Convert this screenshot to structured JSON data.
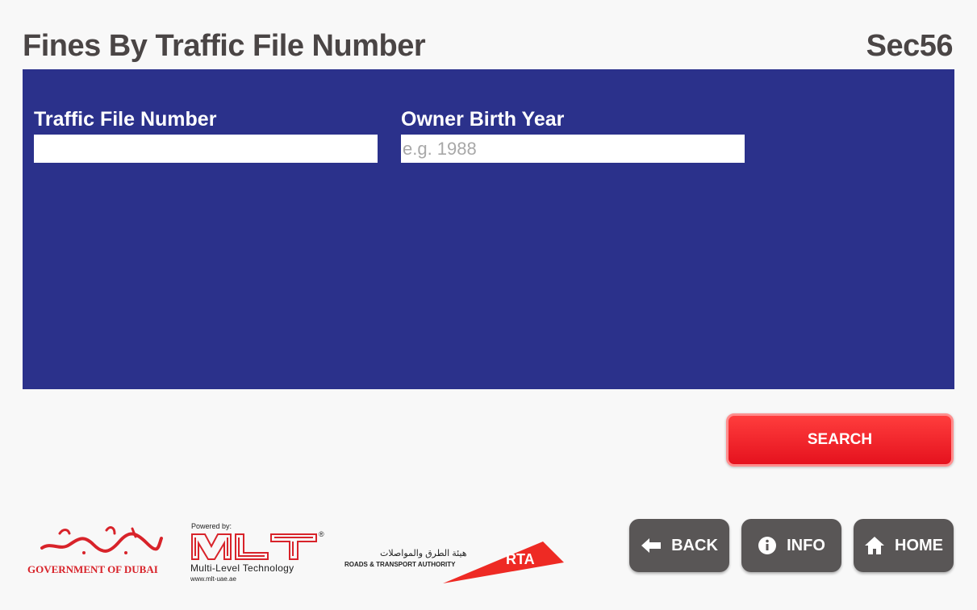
{
  "header": {
    "title": "Fines By Traffic File Number",
    "section_code": "Sec56"
  },
  "form": {
    "traffic_file_number": {
      "label": "Traffic File Number",
      "value": "",
      "placeholder": ""
    },
    "owner_birth_year": {
      "label": "Owner Birth Year",
      "value": "",
      "placeholder": "e.g. 1988"
    }
  },
  "actions": {
    "search_label": "SEARCH"
  },
  "nav": {
    "back": {
      "label": "BACK",
      "icon": "arrow-left-icon"
    },
    "info": {
      "label": "INFO",
      "icon": "info-icon"
    },
    "home": {
      "label": "HOME",
      "icon": "home-icon"
    }
  },
  "footer": {
    "government": {
      "arabic": "حكومة دبي",
      "english": "GOVERNMENT OF DUBAI"
    },
    "mlt": {
      "powered_by": "Powered by:",
      "mark": "MLT",
      "registered": "®",
      "name": "Multi-Level Technology",
      "url": "www.mlt-uae.ae"
    },
    "rta": {
      "arabic": "هيئة الطرق والمواصلات",
      "english": "ROADS & TRANSPORT AUTHORITY",
      "mark": "RTA"
    }
  },
  "colors": {
    "panel": "#2b318b",
    "search_button": "#f1262d",
    "nav_button": "#595656",
    "title_text": "#4a4545",
    "brand_red": "#d8232a"
  }
}
